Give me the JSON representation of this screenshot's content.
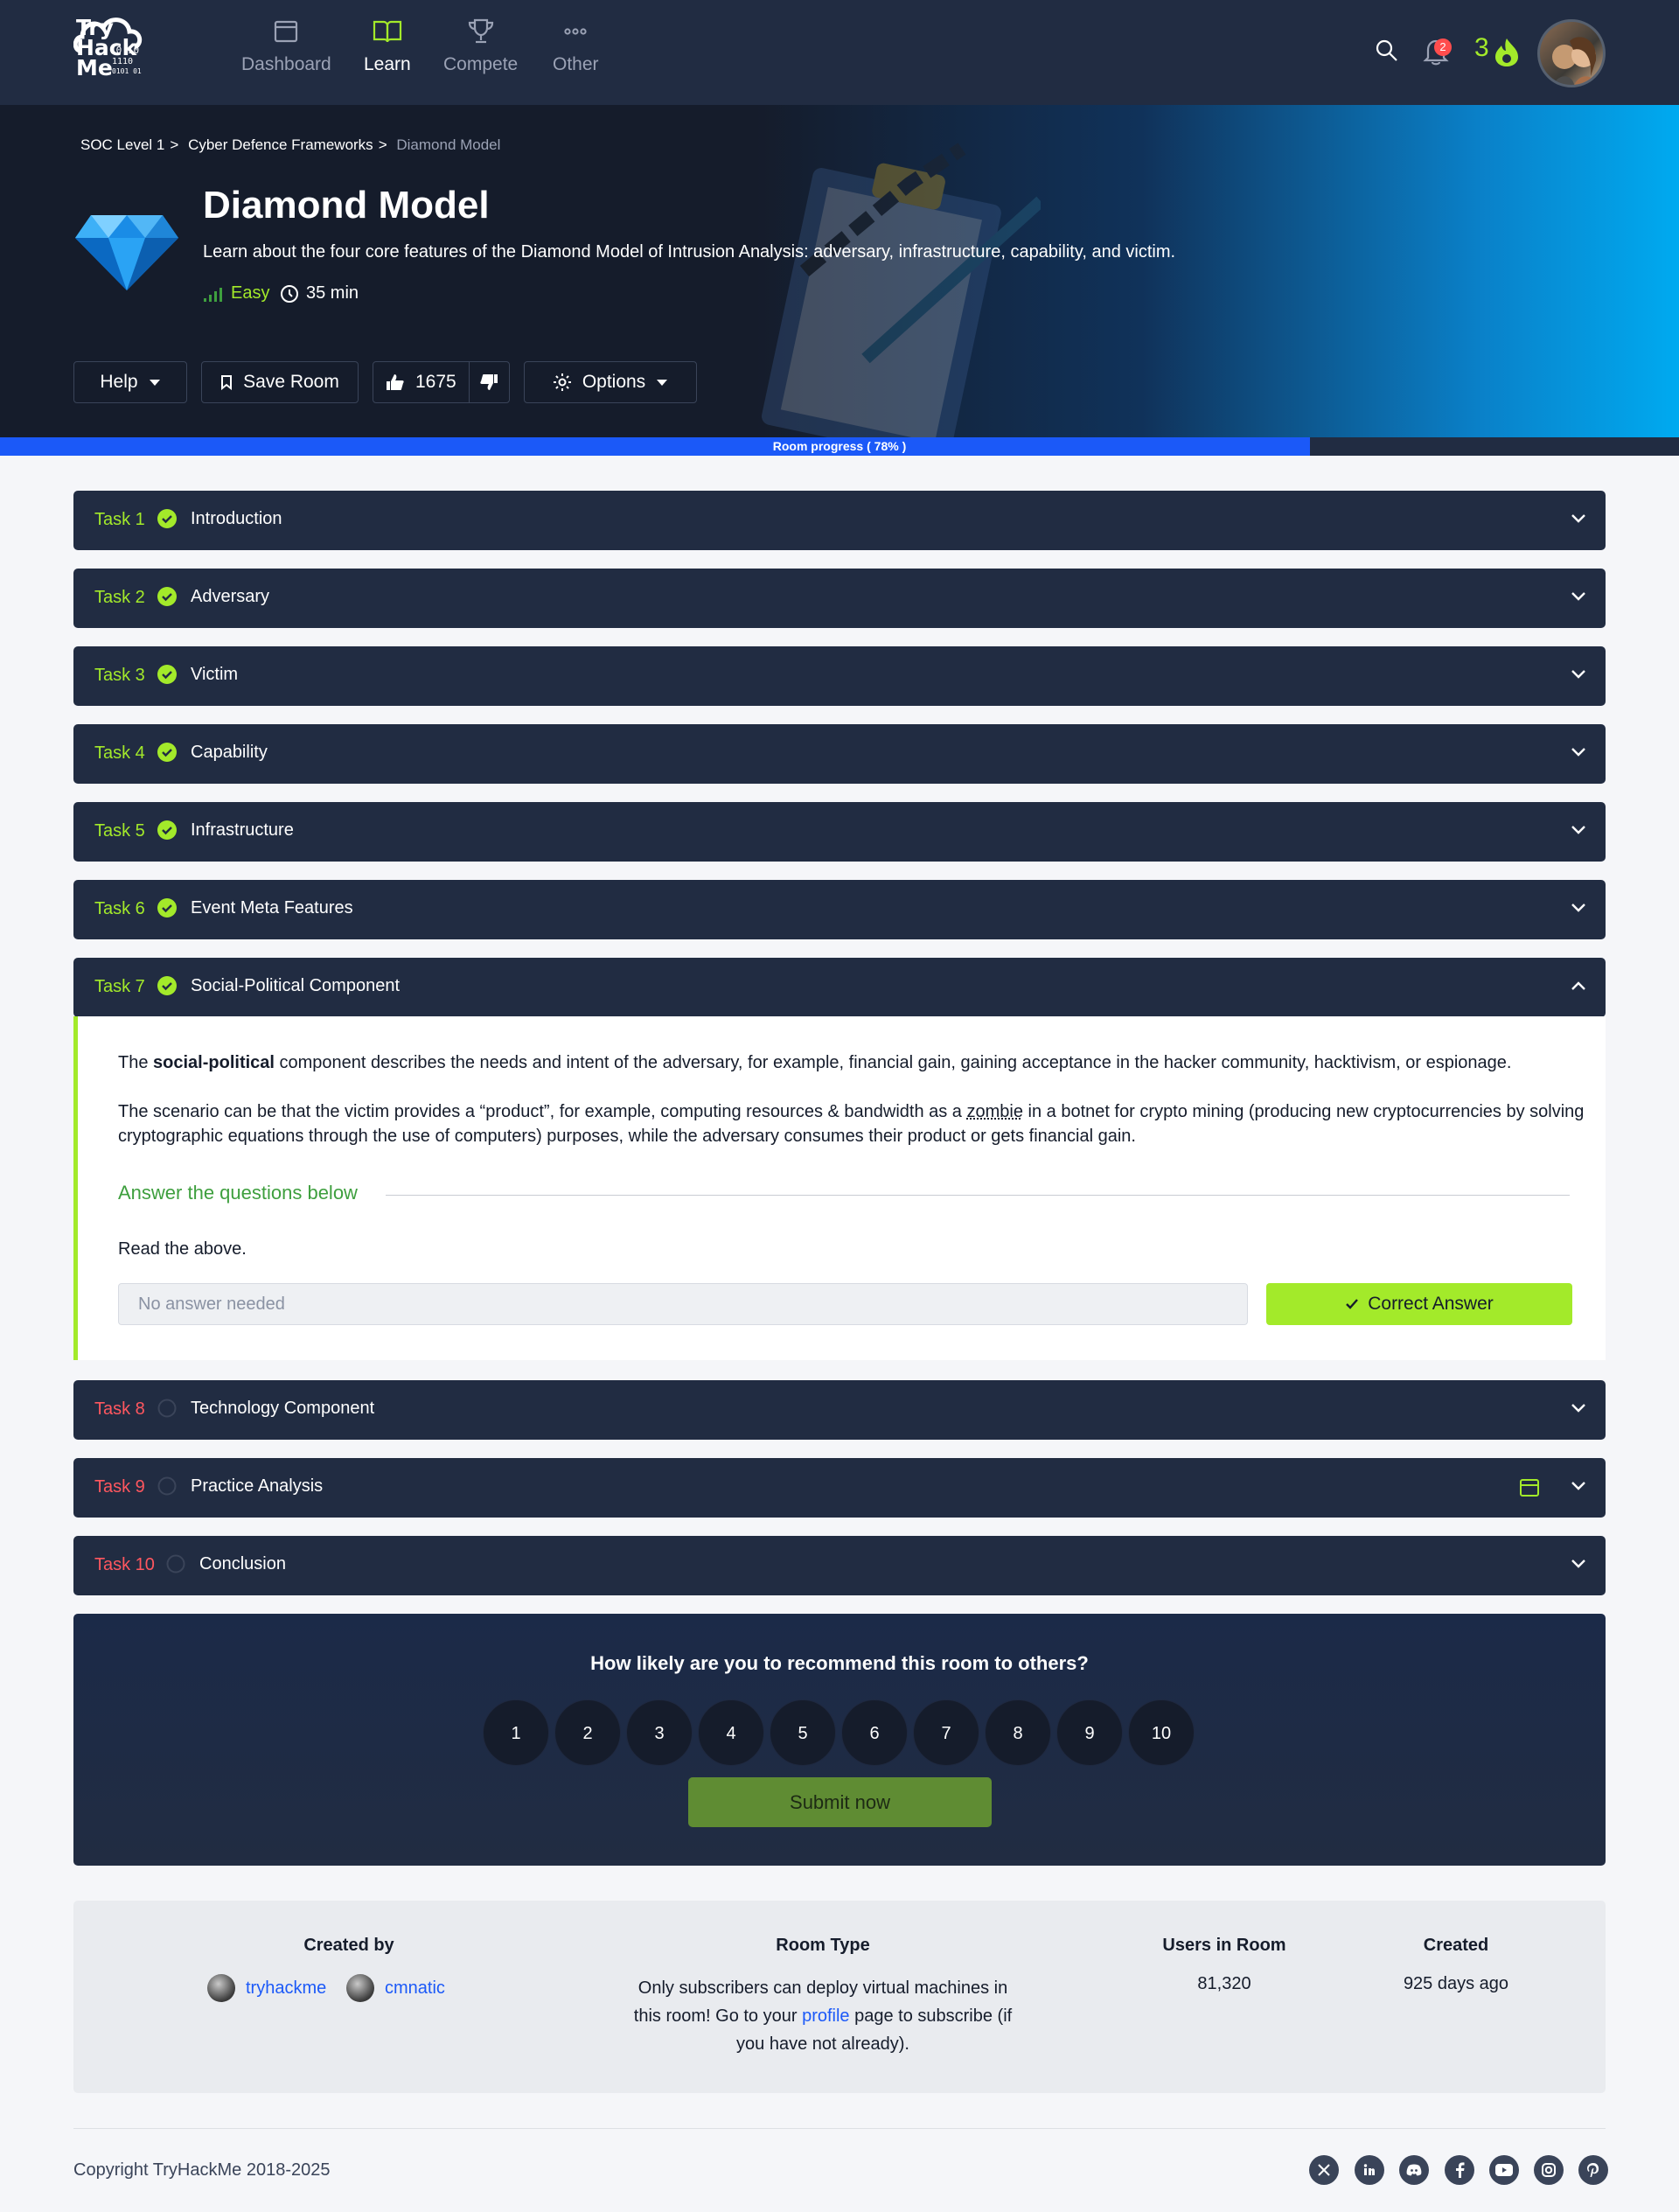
{
  "nav": {
    "logo_text": [
      "Try",
      "Hack",
      "Me"
    ],
    "logo_digits": "10 10 1110 0101 01",
    "items": [
      {
        "label": "Dashboard",
        "icon": "dashboard-icon"
      },
      {
        "label": "Learn",
        "icon": "book-icon"
      },
      {
        "label": "Compete",
        "icon": "trophy-icon"
      },
      {
        "label": "Other",
        "icon": "more-dots-icon"
      }
    ],
    "active": "Learn",
    "notification_count": "2",
    "streak": "3"
  },
  "breadcrumb": [
    "SOC Level 1",
    "Cyber Defence Frameworks",
    "Diamond Model"
  ],
  "room": {
    "title": "Diamond Model",
    "description": "Learn about the four core features of the Diamond Model of Intrusion Analysis: adversary, infrastructure, capability, and victim.",
    "difficulty": "Easy",
    "duration": "35 min"
  },
  "actions": {
    "help": "Help",
    "save": "Save Room",
    "likes": "1675",
    "options": "Options"
  },
  "progress": {
    "label": "Room progress ( 78% )",
    "value": 0.78
  },
  "tasks": [
    {
      "num": "Task 1",
      "name": "Introduction",
      "done": true
    },
    {
      "num": "Task 2",
      "name": "Adversary",
      "done": true
    },
    {
      "num": "Task 3",
      "name": "Victim",
      "done": true
    },
    {
      "num": "Task 4",
      "name": "Capability",
      "done": true
    },
    {
      "num": "Task 5",
      "name": "Infrastructure",
      "done": true
    },
    {
      "num": "Task 6",
      "name": "Event Meta Features",
      "done": true
    },
    {
      "num": "Task 7",
      "name": "Social-Political Component",
      "done": true
    },
    {
      "num": "Task 8",
      "name": "Technology Component",
      "done": false
    },
    {
      "num": "Task 9",
      "name": "Practice Analysis",
      "done": false
    },
    {
      "num": "Task 10",
      "name": "Conclusion",
      "done": false
    }
  ],
  "task7": {
    "p1_pre": "The ",
    "p1_bold": "social-political",
    "p1_post": " component describes the needs and intent of the adversary, for example, financial gain, gaining acceptance in the hacker community, hacktivism, or espionage.",
    "p2_pre": "The scenario can be that the victim provides a “product”, for example, computing resources & bandwidth as a ",
    "p2_link": "zombie",
    "p2_post": " in a botnet for crypto mining (producing new cryptocurrencies by solving cryptographic equations through the use of computers) purposes, while the adversary consumes their product or gets financial gain.",
    "answer_heading": "Answer the questions below",
    "question": "Read the above.",
    "answer_placeholder": "No answer needed",
    "correct_label": "Correct Answer"
  },
  "feedback": {
    "question": "How likely are you to recommend this room to others?",
    "options": [
      "1",
      "2",
      "3",
      "4",
      "5",
      "6",
      "7",
      "8",
      "9",
      "10"
    ],
    "submit": "Submit now"
  },
  "info": {
    "created_by_label": "Created by",
    "creators": [
      "tryhackme",
      "cmnatic"
    ],
    "room_type_label": "Room Type",
    "room_type_pre": "Only subscribers can deploy virtual machines in this room! Go to your ",
    "room_type_link": "profile",
    "room_type_post": " page to subscribe (if you have not already).",
    "users_label": "Users in Room",
    "users": "81,320",
    "created_label": "Created",
    "created": "925 days ago"
  },
  "footer": {
    "copyright": "Copyright TryHackMe 2018-2025",
    "social": [
      "x-icon",
      "linkedin-icon",
      "discord-icon",
      "facebook-icon",
      "youtube-icon",
      "instagram-icon",
      "pinterest-icon"
    ]
  },
  "colors": {
    "accent": "#a3ea2a",
    "nav_bg": "#212c42",
    "progress": "#1b59f8",
    "pending": "#ff575f"
  }
}
